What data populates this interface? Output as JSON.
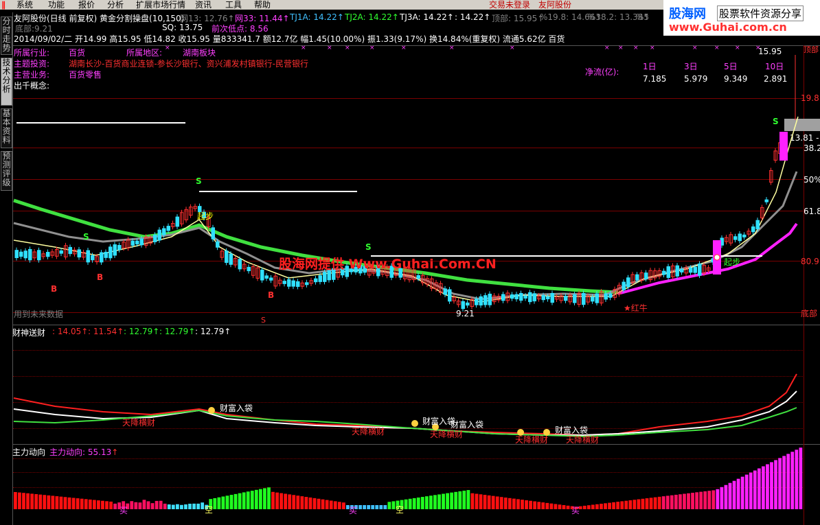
{
  "menu": {
    "items": [
      "系统",
      "功能",
      "报价",
      "分析",
      "扩展市场行情",
      "资讯",
      "工具",
      "帮助"
    ],
    "trade_status": "交易未登录",
    "stock_name": "友阿股份"
  },
  "side_tabs": [
    "分时走势",
    "技术分析",
    "基本资料",
    "预测评级"
  ],
  "logo": {
    "line1": "股海网",
    "line2": "股票软件资源分享",
    "url": "www.Guhai.com.cn"
  },
  "header": {
    "title": "友阿股份(日线 前复权)",
    "indicator": "黄金分割操盘(10,150)",
    "values": [
      {
        "label": "网13:",
        "value": "12.76",
        "color": "#808080"
      },
      {
        "label": "网33:",
        "value": "11.44",
        "color": "#ff40ff"
      },
      {
        "label": "TJ1A:",
        "value": "14.22",
        "color": "#40c0ff"
      },
      {
        "label": "TJ2A:",
        "value": "14.22",
        "color": "#30ff30"
      },
      {
        "label": "TJ3A:",
        "value": "14.22",
        "color": "#ffffff"
      },
      {
        "label": ":",
        "value": "14.22",
        "color": "#ffffff"
      },
      {
        "label": "顶部:",
        "value": "15.95",
        "color": "#808080"
      },
      {
        "label": "%19.8:",
        "value": "14.66",
        "color": "#808080"
      },
      {
        "label": "%38.2:",
        "value": "13.38",
        "color": "#808080"
      },
      {
        "label": "%5",
        "value": "",
        "color": "#808080"
      }
    ],
    "row2": {
      "bottom_label": "底部:",
      "bottom_value": "9.21",
      "sq_label": "SQ:",
      "sq_value": "13.75",
      "prev_low_label": "前次低点:",
      "prev_low_value": "8.56"
    },
    "row3": "2014/09/02/二 开14.99 高15.95 低14.82 收15.95 量833341.7 额12.7亿 幅1.45(10.00%) 振1.33(9.17%) 换14.84%(重复权) 流通5.62亿 百货"
  },
  "info": {
    "industry_label": "所属行业:",
    "industry": "百货",
    "region_label": "所属地区:",
    "region": "湖南板块",
    "invest_label": "主题投资:",
    "invest": "湖南长沙-百货商业连锁-参长沙银行、资兴浦发村镇银行-民营银行",
    "business_label": "主营业务:",
    "business": "百货零售",
    "concept_label": "出千概念:"
  },
  "netflow": {
    "label": "净流(亿):",
    "headers": [
      "1日",
      "3日",
      "5日",
      "10日"
    ],
    "values": [
      "7.185",
      "5.979",
      "9.349",
      "2.891"
    ]
  },
  "price_axis": [
    "15.95",
    "19.8",
    "38.2",
    "50%",
    "61.8",
    "80.9",
    "底部"
  ],
  "axis_extra": {
    "top": "顶部",
    "fib": "13.81 - 1"
  },
  "chart_labels": {
    "qibu1": "起步",
    "qibu2": "起步",
    "hongniu": "★红牛",
    "low": "9.21",
    "future": "用到未来数据",
    "watermark": "股海网提供 Www.Guhai.Com.CN",
    "signals": [
      "S",
      "S",
      "B",
      "B",
      "B",
      "S",
      "S",
      "S"
    ]
  },
  "panel2": {
    "title": "财神送财",
    "values": [
      {
        "v": "14.05",
        "c": "#ff3030"
      },
      {
        "v": "11.54",
        "c": "#ff3030"
      },
      {
        "v": "12.79",
        "c": "#30ff30"
      },
      {
        "v": "12.79",
        "c": "#30ff30"
      },
      {
        "v": "12.79",
        "c": "#ffffff"
      }
    ],
    "labels": {
      "caifu": "财富入袋",
      "tianjiang": "天降横财"
    }
  },
  "panel3": {
    "title": "主力动向",
    "sub_label": "主力动向:",
    "sub_value": "55.13",
    "marks": [
      "买",
      "空",
      "买",
      "空",
      "买"
    ]
  },
  "colors": {
    "up": "#ff3030",
    "down": "#30e0ff",
    "grid": "#7a0000",
    "ma_green": "#40e040",
    "ma_gray": "#909090",
    "ma_mag": "#ff20ff"
  }
}
